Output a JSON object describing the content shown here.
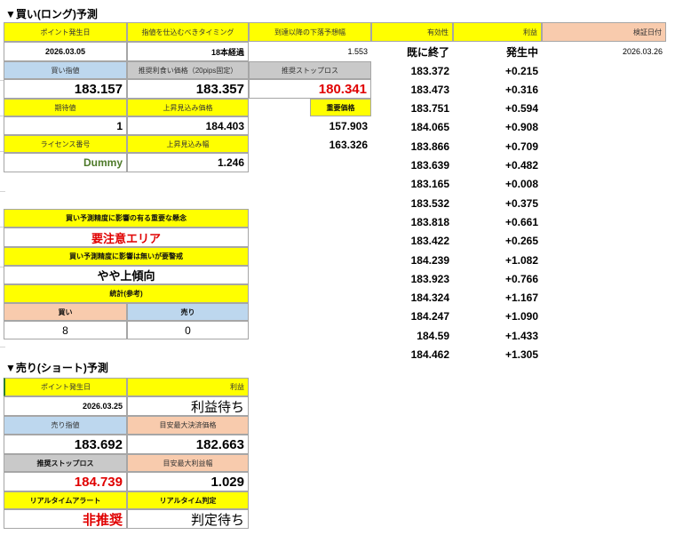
{
  "long": {
    "title": "▼買い(ロング)予測",
    "h_point_date": "ポイント発生日",
    "h_timing": "指値を仕込むべきタイミング",
    "h_next_target": "到達以降の下落予想幅",
    "h_validity": "有効性",
    "h_profit": "利益",
    "h_verify_date": "検証日付",
    "point_date": "2026.03.05",
    "timing": "18本経過",
    "next_target": "1.553",
    "validity": "既に終了",
    "profit_status": "発生中",
    "verify_date": "2026.03.26",
    "h_buy_price": "買い指値",
    "h_recommended": "推奨利食い価格（20pips固定）",
    "h_stop": "推奨ストップロス",
    "buy_price": "183.157",
    "recommended": "183.357",
    "stop": "180.341",
    "h_expected": "期待値",
    "h_rise_price": "上昇見込み価格",
    "h_important": "重要価格",
    "expected": "1",
    "rise_price": "184.403",
    "important1": "157.903",
    "important2": "163.326",
    "h_license": "ライセンス番号",
    "h_rise_width": "上昇見込み幅",
    "license": "Dummy",
    "rise_width": "1.246",
    "h_caution": "買い予測精度に影響の有る重要な懸念",
    "caution": "要注意エリア",
    "h_trend": "買い予測精度に影響は無いが要警戒",
    "trend": "やや上傾向",
    "h_stats": "統計(参考)",
    "h_buy_count": "買い",
    "h_sell_count": "売り",
    "buy_count": "8",
    "sell_count": "0"
  },
  "price_list": [
    {
      "price": "183.372",
      "diff": "+0.215"
    },
    {
      "price": "183.473",
      "diff": "+0.316"
    },
    {
      "price": "183.751",
      "diff": "+0.594"
    },
    {
      "price": "184.065",
      "diff": "+0.908"
    },
    {
      "price": "183.866",
      "diff": "+0.709"
    },
    {
      "price": "183.639",
      "diff": "+0.482"
    },
    {
      "price": "183.165",
      "diff": "+0.008"
    },
    {
      "price": "183.532",
      "diff": "+0.375"
    },
    {
      "price": "183.818",
      "diff": "+0.661"
    },
    {
      "price": "183.422",
      "diff": "+0.265"
    },
    {
      "price": "184.239",
      "diff": "+1.082"
    },
    {
      "price": "183.923",
      "diff": "+0.766"
    },
    {
      "price": "184.324",
      "diff": "+1.167"
    },
    {
      "price": "184.247",
      "diff": "+1.090"
    },
    {
      "price": "184.59",
      "diff": "+1.433"
    },
    {
      "price": "184.462",
      "diff": "+1.305"
    }
  ],
  "short": {
    "title": "▼売り(ショート)予測",
    "h_point_date": "ポイント発生日",
    "h_profit": "利益",
    "point_date": "2026.03.25",
    "profit": "利益待ち",
    "h_sell_price": "売り指値",
    "h_max_settle": "目安最大決済価格",
    "sell_price": "183.692",
    "max_settle": "182.663",
    "h_stop": "推奨ストップロス",
    "h_max_profit": "目安最大利益幅",
    "stop": "184.739",
    "max_profit": "1.029",
    "h_alert": "リアルタイムアラート",
    "h_judge": "リアルタイム判定",
    "alert": "非推奨",
    "judge": "判定待ち"
  }
}
